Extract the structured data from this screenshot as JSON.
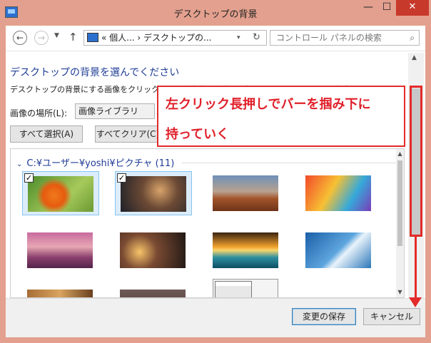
{
  "titlebar": {
    "title": "デスクトップの背景",
    "minimize_glyph": "—",
    "maximize_glyph": "☐",
    "close_glyph": "✕"
  },
  "nav": {
    "back_glyph": "←",
    "forward_glyph": "→",
    "history_glyph": "▼",
    "up_glyph": "↑",
    "address": "« 個人... › デスクトップの...",
    "address_dropdown_glyph": "▾",
    "refresh_glyph": "↻",
    "search_placeholder": "コントロール パネルの検索",
    "search_glyph": "⌕"
  },
  "main": {
    "heading": "デスクトップの背景を選んでください",
    "description": "デスクトップの背景にする画像をクリックするか、複数の画像を選択してスライド ショーを作成します。",
    "location_label": "画像の場所(L):",
    "location_value": "画像ライブラリ",
    "select_all": "すべて選択(A)",
    "clear_all": "すべてクリア(C)"
  },
  "gallery": {
    "chevron_glyph": "⌄",
    "group_title": "C:¥ユーザー¥yoshi¥ピクチャ (11)",
    "check_glyph": "✓",
    "scroll_up_glyph": "▲",
    "scroll_down_glyph": "▼"
  },
  "outer_scroll": {
    "up_glyph": "▲",
    "down_glyph": "⌄"
  },
  "annotation": {
    "line1": "左クリック長押しでバーを掴み下に",
    "line2": "持っていく",
    "color": "#e32a2a"
  },
  "footer": {
    "save": "変更の保存",
    "cancel": "キャンセル"
  }
}
